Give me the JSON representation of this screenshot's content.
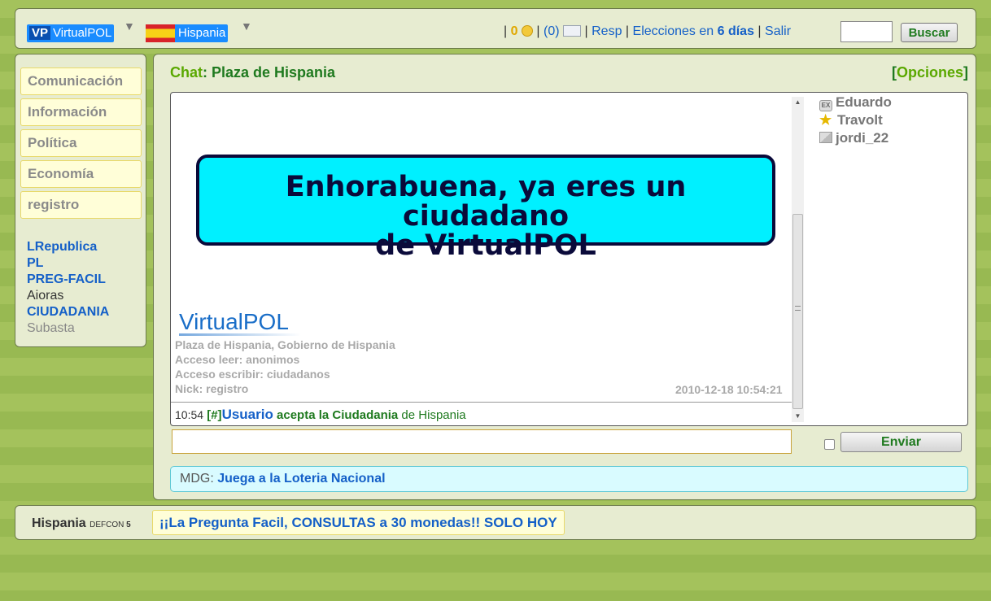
{
  "header": {
    "vp_abbr": "VP",
    "site_name": "VirtualPOL",
    "country": "Hispania",
    "coins": "0",
    "messages": "(0)",
    "resp_label": "Resp",
    "elections_prefix": "Elecciones en",
    "elections_days": "6 días",
    "logout": "Salir",
    "search_button": "Buscar",
    "search_value": ""
  },
  "sidebar": {
    "menu": [
      "Comunicación",
      "Información",
      "Política",
      "Economía",
      "registro"
    ],
    "links": [
      "LRepublica",
      "PL",
      "PREG-FACIL",
      "Aioras",
      "CIUDADANIA",
      "Subasta"
    ]
  },
  "chat": {
    "title_label": "Chat",
    "title_name": "Plaza de Hispania",
    "options": "Opciones",
    "banner_line1": "Enhorabuena, ya eres un ciudadano",
    "banner_line2": "de VirtualPOL",
    "logo_text": "VirtualPOL",
    "info": [
      "Plaza de Hispania, Gobierno de Hispania",
      "Acceso leer: anonimos",
      "Acceso escribir: ciudadanos",
      "Nick: registro"
    ],
    "timestamp": "2010-12-18 10:54:21",
    "message": {
      "time": "10:54",
      "hash": "[#]",
      "user": "Usuario",
      "text_bold": "acepta la Ciudadania",
      "text_rest": "de Hispania"
    },
    "users": [
      {
        "name": "Eduardo",
        "icon": "ex-citizen-icon"
      },
      {
        "name": "Travolt",
        "icon": "star-icon"
      },
      {
        "name": "jordi_22",
        "icon": "cube-icon"
      }
    ],
    "input_value": "",
    "send_button": "Enviar"
  },
  "mdg": {
    "label": "MDG:",
    "link": "Juega a la Loteria Nacional"
  },
  "footer": {
    "country": "Hispania",
    "defcon_label": "DEFCON",
    "defcon_level": "5",
    "promo": "¡¡La Pregunta Facil, CONSULTAS a 30 monedas!! SOLO HOY"
  },
  "colors": {
    "background_stripe": "#a4c25c",
    "panel": "#e7ecd1",
    "link": "#1560c8",
    "green_text": "#1f7a1f",
    "banner": "#00f0ff"
  }
}
